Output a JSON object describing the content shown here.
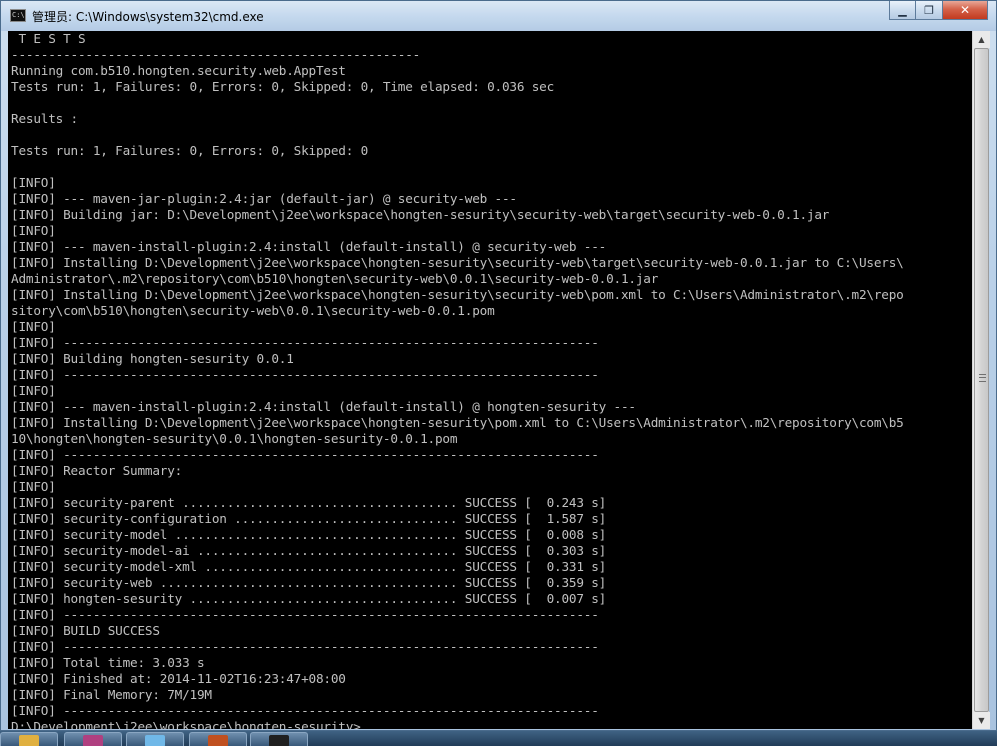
{
  "window": {
    "title": "管理员: C:\\Windows\\system32\\cmd.exe",
    "icon": "cmd-icon",
    "buttons": [
      "minimize",
      "maximize",
      "close"
    ]
  },
  "console": {
    "lines": [
      " T E S T S",
      "-------------------------------------------------------",
      "Running com.b510.hongten.security.web.AppTest",
      "Tests run: 1, Failures: 0, Errors: 0, Skipped: 0, Time elapsed: 0.036 sec",
      "",
      "Results :",
      "",
      "Tests run: 1, Failures: 0, Errors: 0, Skipped: 0",
      "",
      "[INFO]",
      "[INFO] --- maven-jar-plugin:2.4:jar (default-jar) @ security-web ---",
      "[INFO] Building jar: D:\\Development\\j2ee\\workspace\\hongten-sesurity\\security-web\\target\\security-web-0.0.1.jar",
      "[INFO]",
      "[INFO] --- maven-install-plugin:2.4:install (default-install) @ security-web ---",
      "[INFO] Installing D:\\Development\\j2ee\\workspace\\hongten-sesurity\\security-web\\target\\security-web-0.0.1.jar to C:\\Users\\",
      "Administrator\\.m2\\repository\\com\\b510\\hongten\\security-web\\0.0.1\\security-web-0.0.1.jar",
      "[INFO] Installing D:\\Development\\j2ee\\workspace\\hongten-sesurity\\security-web\\pom.xml to C:\\Users\\Administrator\\.m2\\repo",
      "sitory\\com\\b510\\hongten\\security-web\\0.0.1\\security-web-0.0.1.pom",
      "[INFO]",
      "[INFO] ------------------------------------------------------------------------",
      "[INFO] Building hongten-sesurity 0.0.1",
      "[INFO] ------------------------------------------------------------------------",
      "[INFO]",
      "[INFO] --- maven-install-plugin:2.4:install (default-install) @ hongten-sesurity ---",
      "[INFO] Installing D:\\Development\\j2ee\\workspace\\hongten-sesurity\\pom.xml to C:\\Users\\Administrator\\.m2\\repository\\com\\b5",
      "10\\hongten\\hongten-sesurity\\0.0.1\\hongten-sesurity-0.0.1.pom",
      "[INFO] ------------------------------------------------------------------------",
      "[INFO] Reactor Summary:",
      "[INFO]",
      "[INFO] security-parent ..................................... SUCCESS [  0.243 s]",
      "[INFO] security-configuration .............................. SUCCESS [  1.587 s]",
      "[INFO] security-model ...................................... SUCCESS [  0.008 s]",
      "[INFO] security-model-ai ................................... SUCCESS [  0.303 s]",
      "[INFO] security-model-xml .................................. SUCCESS [  0.331 s]",
      "[INFO] security-web ........................................ SUCCESS [  0.359 s]",
      "[INFO] hongten-sesurity .................................... SUCCESS [  0.007 s]",
      "[INFO] ------------------------------------------------------------------------",
      "[INFO] BUILD SUCCESS",
      "[INFO] ------------------------------------------------------------------------",
      "[INFO] Total time: 3.033 s",
      "[INFO] Finished at: 2014-11-02T16:23:47+08:00",
      "[INFO] Final Memory: 7M/19M",
      "[INFO] ------------------------------------------------------------------------",
      "D:\\Development\\j2ee\\workspace\\hongten-sesurity>"
    ]
  },
  "taskbar": {
    "items": [
      {
        "icon": "folder-icon",
        "color": "#e0b040"
      },
      {
        "icon": "archive-icon",
        "color": "#b04080"
      },
      {
        "icon": "browser-icon",
        "color": "#70b8e8"
      },
      {
        "icon": "java-ee-icon",
        "color": "#c05020"
      },
      {
        "icon": "cmd-icon",
        "color": "#202020"
      }
    ]
  }
}
